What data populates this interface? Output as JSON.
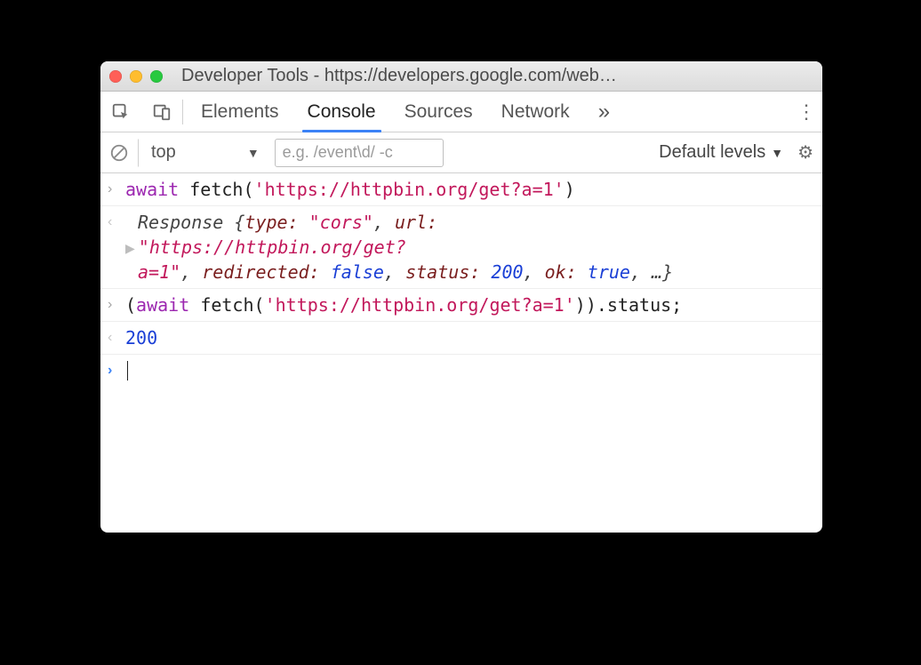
{
  "window": {
    "title": "Developer Tools - https://developers.google.com/web…"
  },
  "tabs": {
    "elements": "Elements",
    "console": "Console",
    "sources": "Sources",
    "network": "Network",
    "more": "»"
  },
  "filter": {
    "context": "top",
    "placeholder": "e.g. /event\\d/ -c",
    "levels": "Default levels"
  },
  "console": {
    "line1": {
      "await": "await",
      "space": " ",
      "fetch": "fetch",
      "open": "(",
      "url": "'https://httpbin.org/get?a=1'",
      "close": ")"
    },
    "resp": {
      "head": "Response ",
      "brace_open": "{",
      "type_k": "type: ",
      "type_v": "\"cors\"",
      "comma1": ", ",
      "url_k": "url: ",
      "url_v1": "\"https://httpbin.org/get?",
      "url_v2": "a=1\"",
      "comma2": ", ",
      "redir_k": "redirected: ",
      "redir_v": "false",
      "comma3": ", ",
      "status_k": "status: ",
      "status_v": "200",
      "comma4": ", ",
      "ok_k": "ok: ",
      "ok_v": "true",
      "rest": ", …}"
    },
    "line2": {
      "popen": "(",
      "await": "await",
      "space": " ",
      "fetch": "fetch",
      "open": "(",
      "url": "'https://httpbin.org/get?a=1'",
      "close": "))",
      "dot": ".status;"
    },
    "result2": "200"
  }
}
